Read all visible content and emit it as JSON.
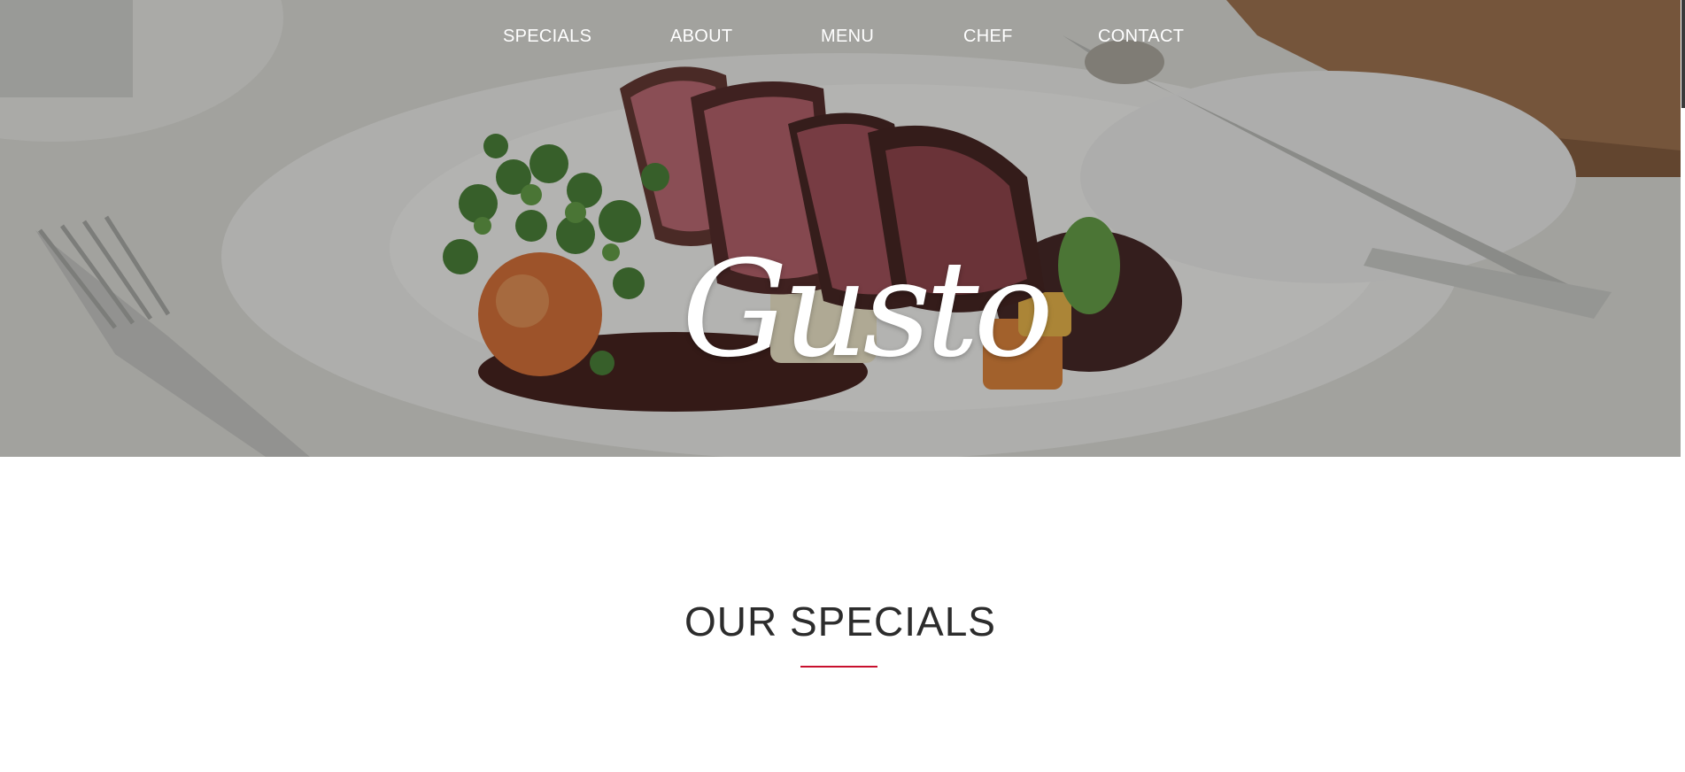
{
  "nav": {
    "items": [
      {
        "label": "SPECIALS"
      },
      {
        "label": "ABOUT"
      },
      {
        "label": "MENU"
      },
      {
        "label": "CHEF"
      },
      {
        "label": "CONTACT"
      }
    ]
  },
  "hero": {
    "logo_text": "Gusto",
    "image_icon": "plated-steak-photo"
  },
  "specials": {
    "title": "OUR SPECIALS",
    "accent_color": "#c8102e"
  }
}
